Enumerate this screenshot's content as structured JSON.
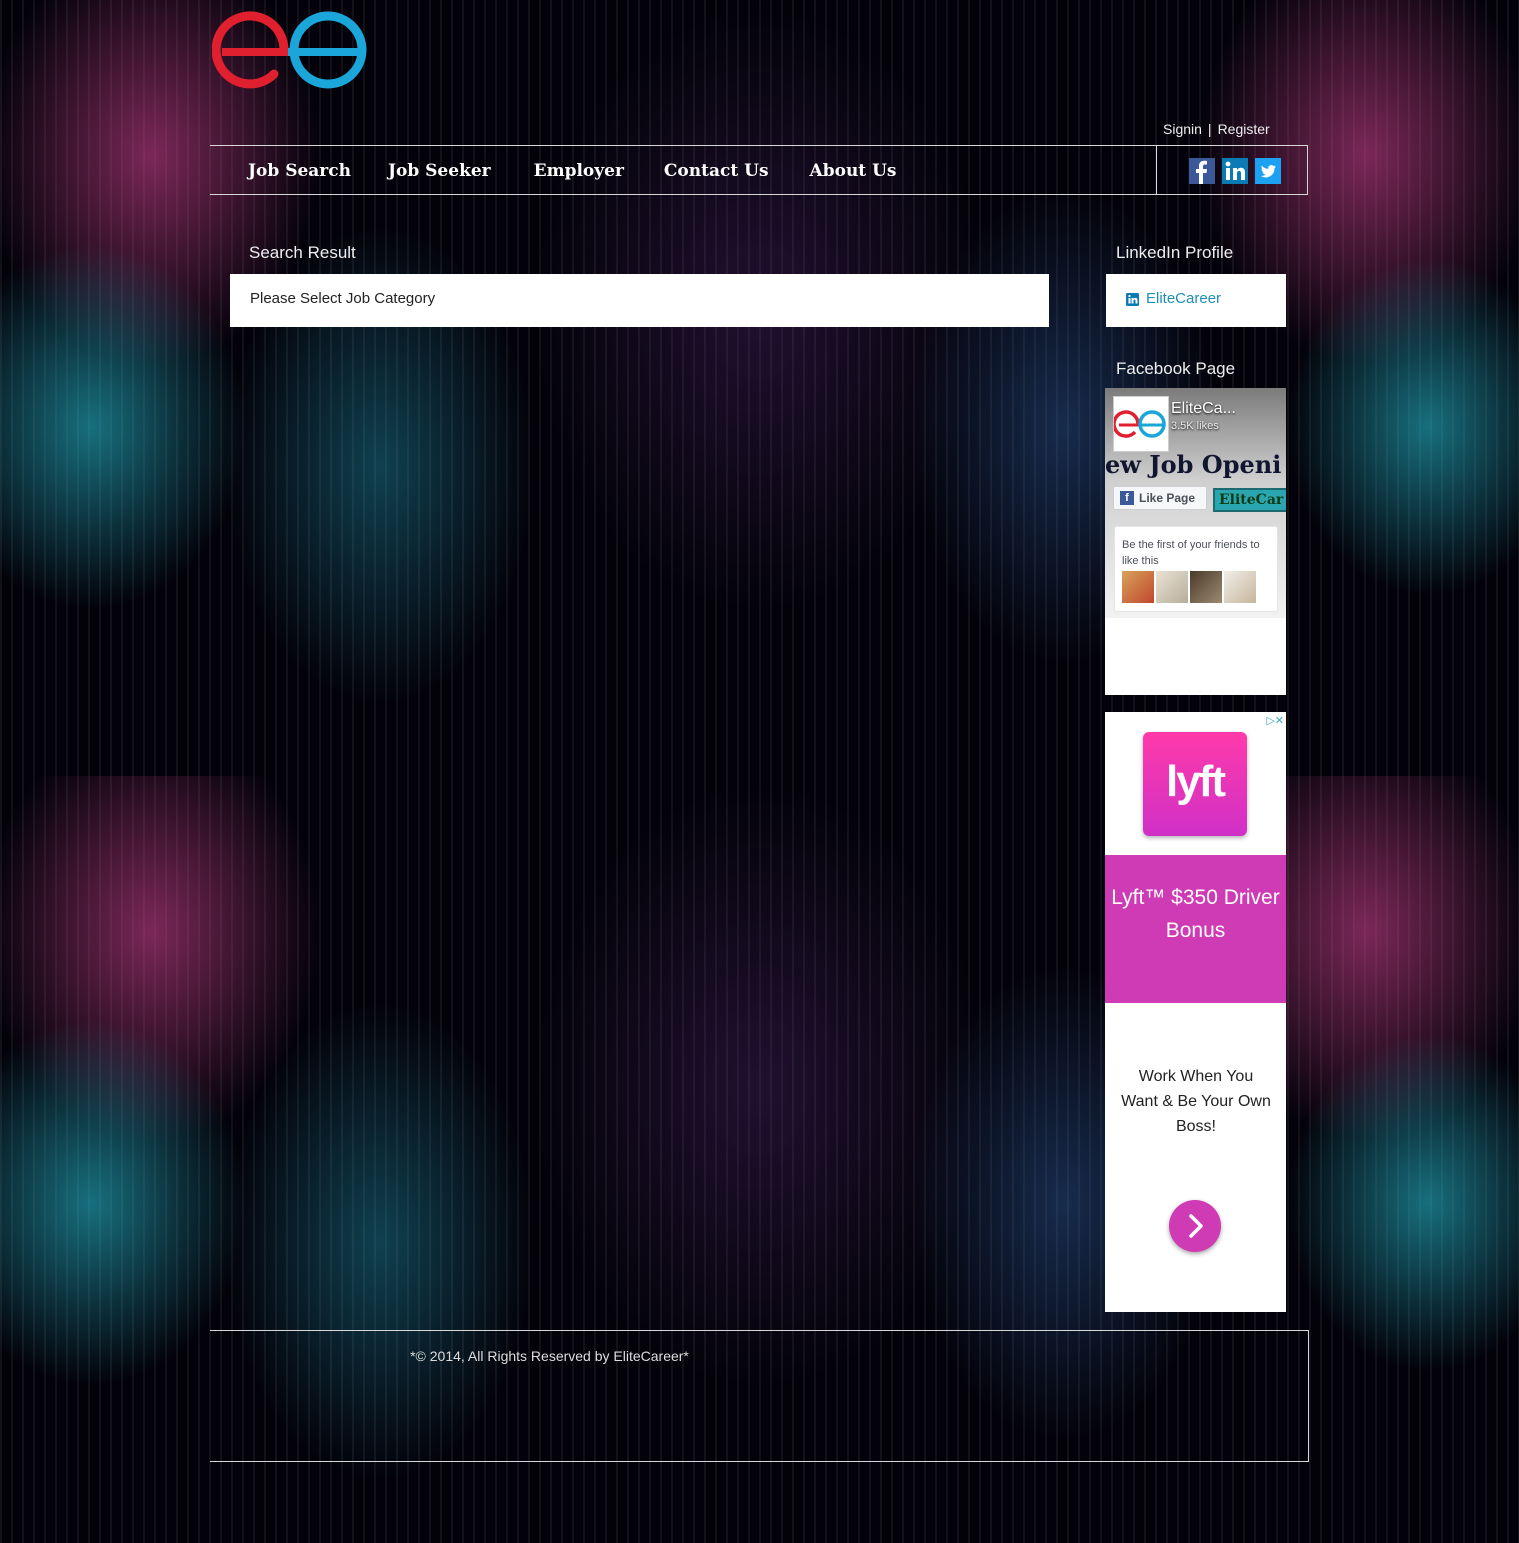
{
  "header": {
    "logo_name": "eo-logo",
    "signin_label": "Signin",
    "separator": "|",
    "register_label": "Register"
  },
  "nav": {
    "items": [
      "Job Search",
      "Job Seeker",
      "Employer",
      "Contact Us",
      "About Us"
    ],
    "social": [
      "facebook-icon",
      "linkedin-icon",
      "twitter-icon"
    ]
  },
  "main": {
    "title": "Search Result",
    "message": "Please Select Job Category"
  },
  "sidebar": {
    "linkedin_title": "LinkedIn Profile",
    "linkedin_link": "EliteCareer",
    "facebook_title": "Facebook Page",
    "facebook_widget": {
      "page_name": "EliteCa...",
      "likes": "3.5K likes",
      "banner_text": "ew Job Openi",
      "like_button": "Like Page",
      "chip_text": "EliteCar",
      "friends_text": "Be the first of your friends to like this"
    },
    "ad": {
      "logo_text": "lyft",
      "headline": "Lyft™ $350 Driver Bonus",
      "body": "Work When You Want & Be Your Own Boss!"
    }
  },
  "footer": {
    "copyright": "*© 2014, All Rights Reserved by EliteCareer*"
  },
  "colors": {
    "logo_red": "#e0202e",
    "logo_blue": "#1aa6d8",
    "facebook": "#3b5998",
    "linkedin": "#0a7bb5",
    "twitter": "#1da1f2",
    "lyft_pink": "#cf3bb4"
  }
}
